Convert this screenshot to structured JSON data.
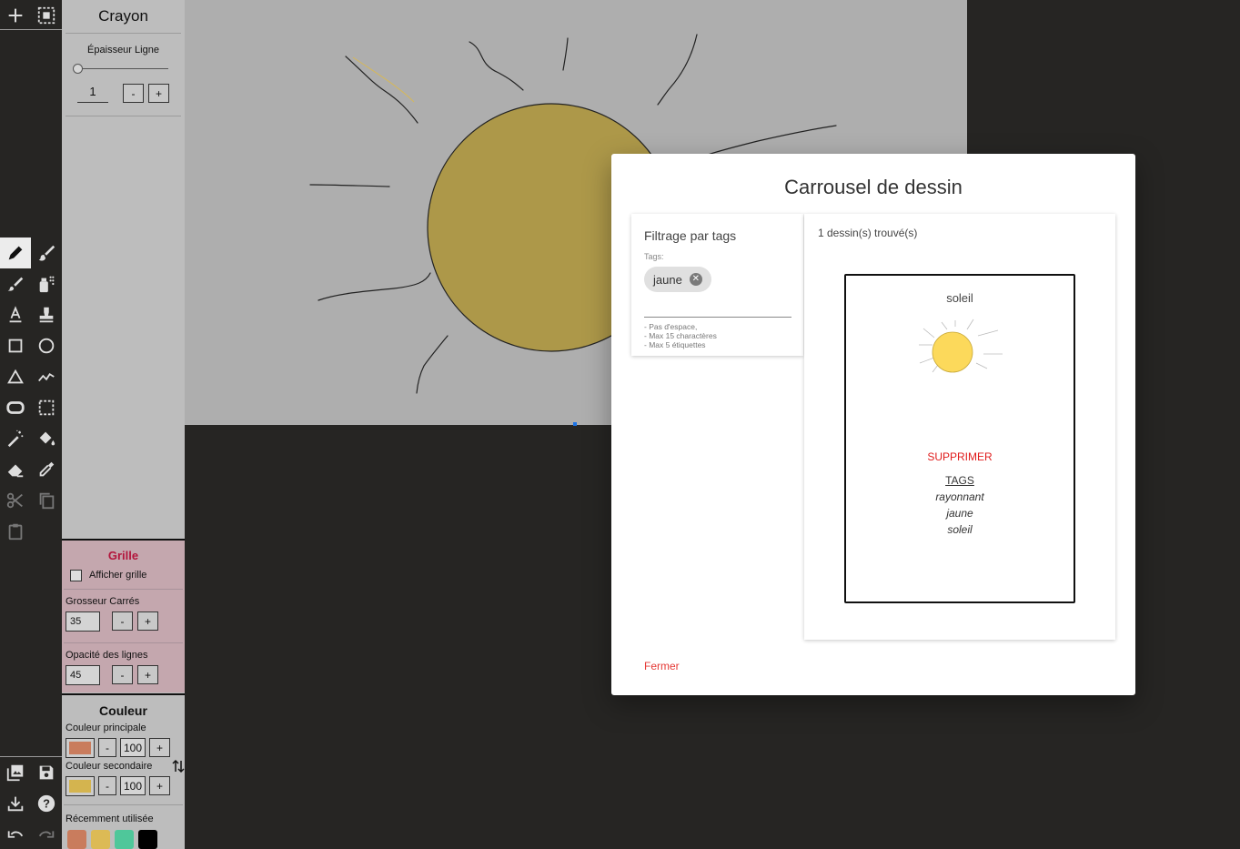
{
  "rail": {
    "top_buttons": [
      {
        "icon": "plus-icon"
      },
      {
        "icon": "select-all-icon"
      }
    ],
    "tools": [
      {
        "icon": "pencil-icon",
        "active": true
      },
      {
        "icon": "brush-icon"
      },
      {
        "icon": "paintbrush-icon"
      },
      {
        "icon": "spray-icon"
      },
      {
        "icon": "text-icon"
      },
      {
        "icon": "stamp-icon"
      },
      {
        "icon": "square-icon"
      },
      {
        "icon": "circle-icon"
      },
      {
        "icon": "triangle-icon"
      },
      {
        "icon": "polyline-icon"
      },
      {
        "icon": "rounded-rect-icon"
      },
      {
        "icon": "selection-icon"
      },
      {
        "icon": "magic-wand-icon"
      },
      {
        "icon": "paint-bucket-icon"
      },
      {
        "icon": "eraser-icon"
      },
      {
        "icon": "eyedropper-icon"
      },
      {
        "icon": "scissors-icon"
      },
      {
        "icon": "copy-icon"
      },
      {
        "icon": "paste-icon"
      }
    ],
    "bottom_buttons": [
      {
        "icon": "gallery-icon"
      },
      {
        "icon": "save-icon"
      },
      {
        "icon": "download-icon"
      },
      {
        "icon": "help-icon"
      },
      {
        "icon": "undo-icon"
      },
      {
        "icon": "redo-icon"
      }
    ]
  },
  "panel": {
    "title": "Crayon",
    "thickness_label": "Épaisseur Ligne",
    "thickness_value": "1",
    "minus": "-",
    "plus": "+"
  },
  "grid": {
    "title": "Grille",
    "show_label": "Afficher grille",
    "show_checked": false,
    "size_label": "Grosseur Carrés",
    "size_value": "35",
    "opacity_label": "Opacité des lignes",
    "opacity_value": "45"
  },
  "color": {
    "title": "Couleur",
    "primary_label": "Couleur principale",
    "primary_color": "#c97c5d",
    "primary_opacity": "100",
    "secondary_label": "Couleur secondaire",
    "secondary_color": "#d4b44f",
    "secondary_opacity": "100",
    "recent_label": "Récemment utilisée",
    "recent_colors": [
      "#c97c5d",
      "#dcba55",
      "#4fc79a",
      "#000000"
    ]
  },
  "modal": {
    "title": "Carrousel de dessin",
    "filter_title": "Filtrage par tags",
    "tags_label": "Tags:",
    "active_tag": "jaune",
    "hints": [
      "- Pas d'espace,",
      "- Max 15 charactères",
      "- Max 5 étiquettes"
    ],
    "found_text": "1 dessin(s) trouvé(s)",
    "drawing": {
      "name": "soleil",
      "delete_label": "SUPPRIMER",
      "tags_heading": "TAGS",
      "tags": [
        "rayonnant",
        "jaune",
        "soleil"
      ]
    },
    "close_label": "Fermer"
  }
}
